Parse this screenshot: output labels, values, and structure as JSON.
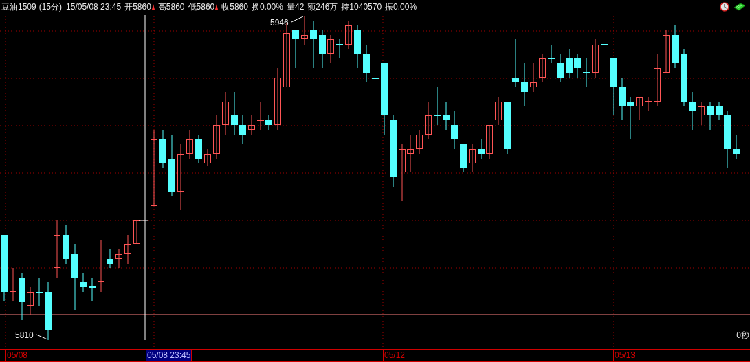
{
  "header": {
    "symbol": "豆油1509",
    "period": "(15分)",
    "time": "15/05/08 23:45",
    "fields": [
      {
        "text": "开5860",
        "marker": true
      },
      {
        "text": "高5860",
        "marker": false
      },
      {
        "text": "低5860",
        "marker": true
      },
      {
        "text": "收5860",
        "marker": false
      },
      {
        "text": "换0.00%",
        "marker": false
      },
      {
        "text": "量42",
        "marker": false
      },
      {
        "text": "额246万",
        "marker": false
      },
      {
        "text": "持1040570",
        "marker": false
      },
      {
        "text": "振0.00%",
        "marker": false
      }
    ]
  },
  "chart": {
    "high_label": "5946",
    "low_label": "5810",
    "countdown": "0秒"
  },
  "x_axis": [
    {
      "text": "05/08",
      "kind": "date"
    },
    {
      "text": "05/08 23:45",
      "kind": "cursor"
    },
    {
      "text": "05/12",
      "kind": "date"
    },
    {
      "text": "05/13",
      "kind": "date"
    }
  ]
}
